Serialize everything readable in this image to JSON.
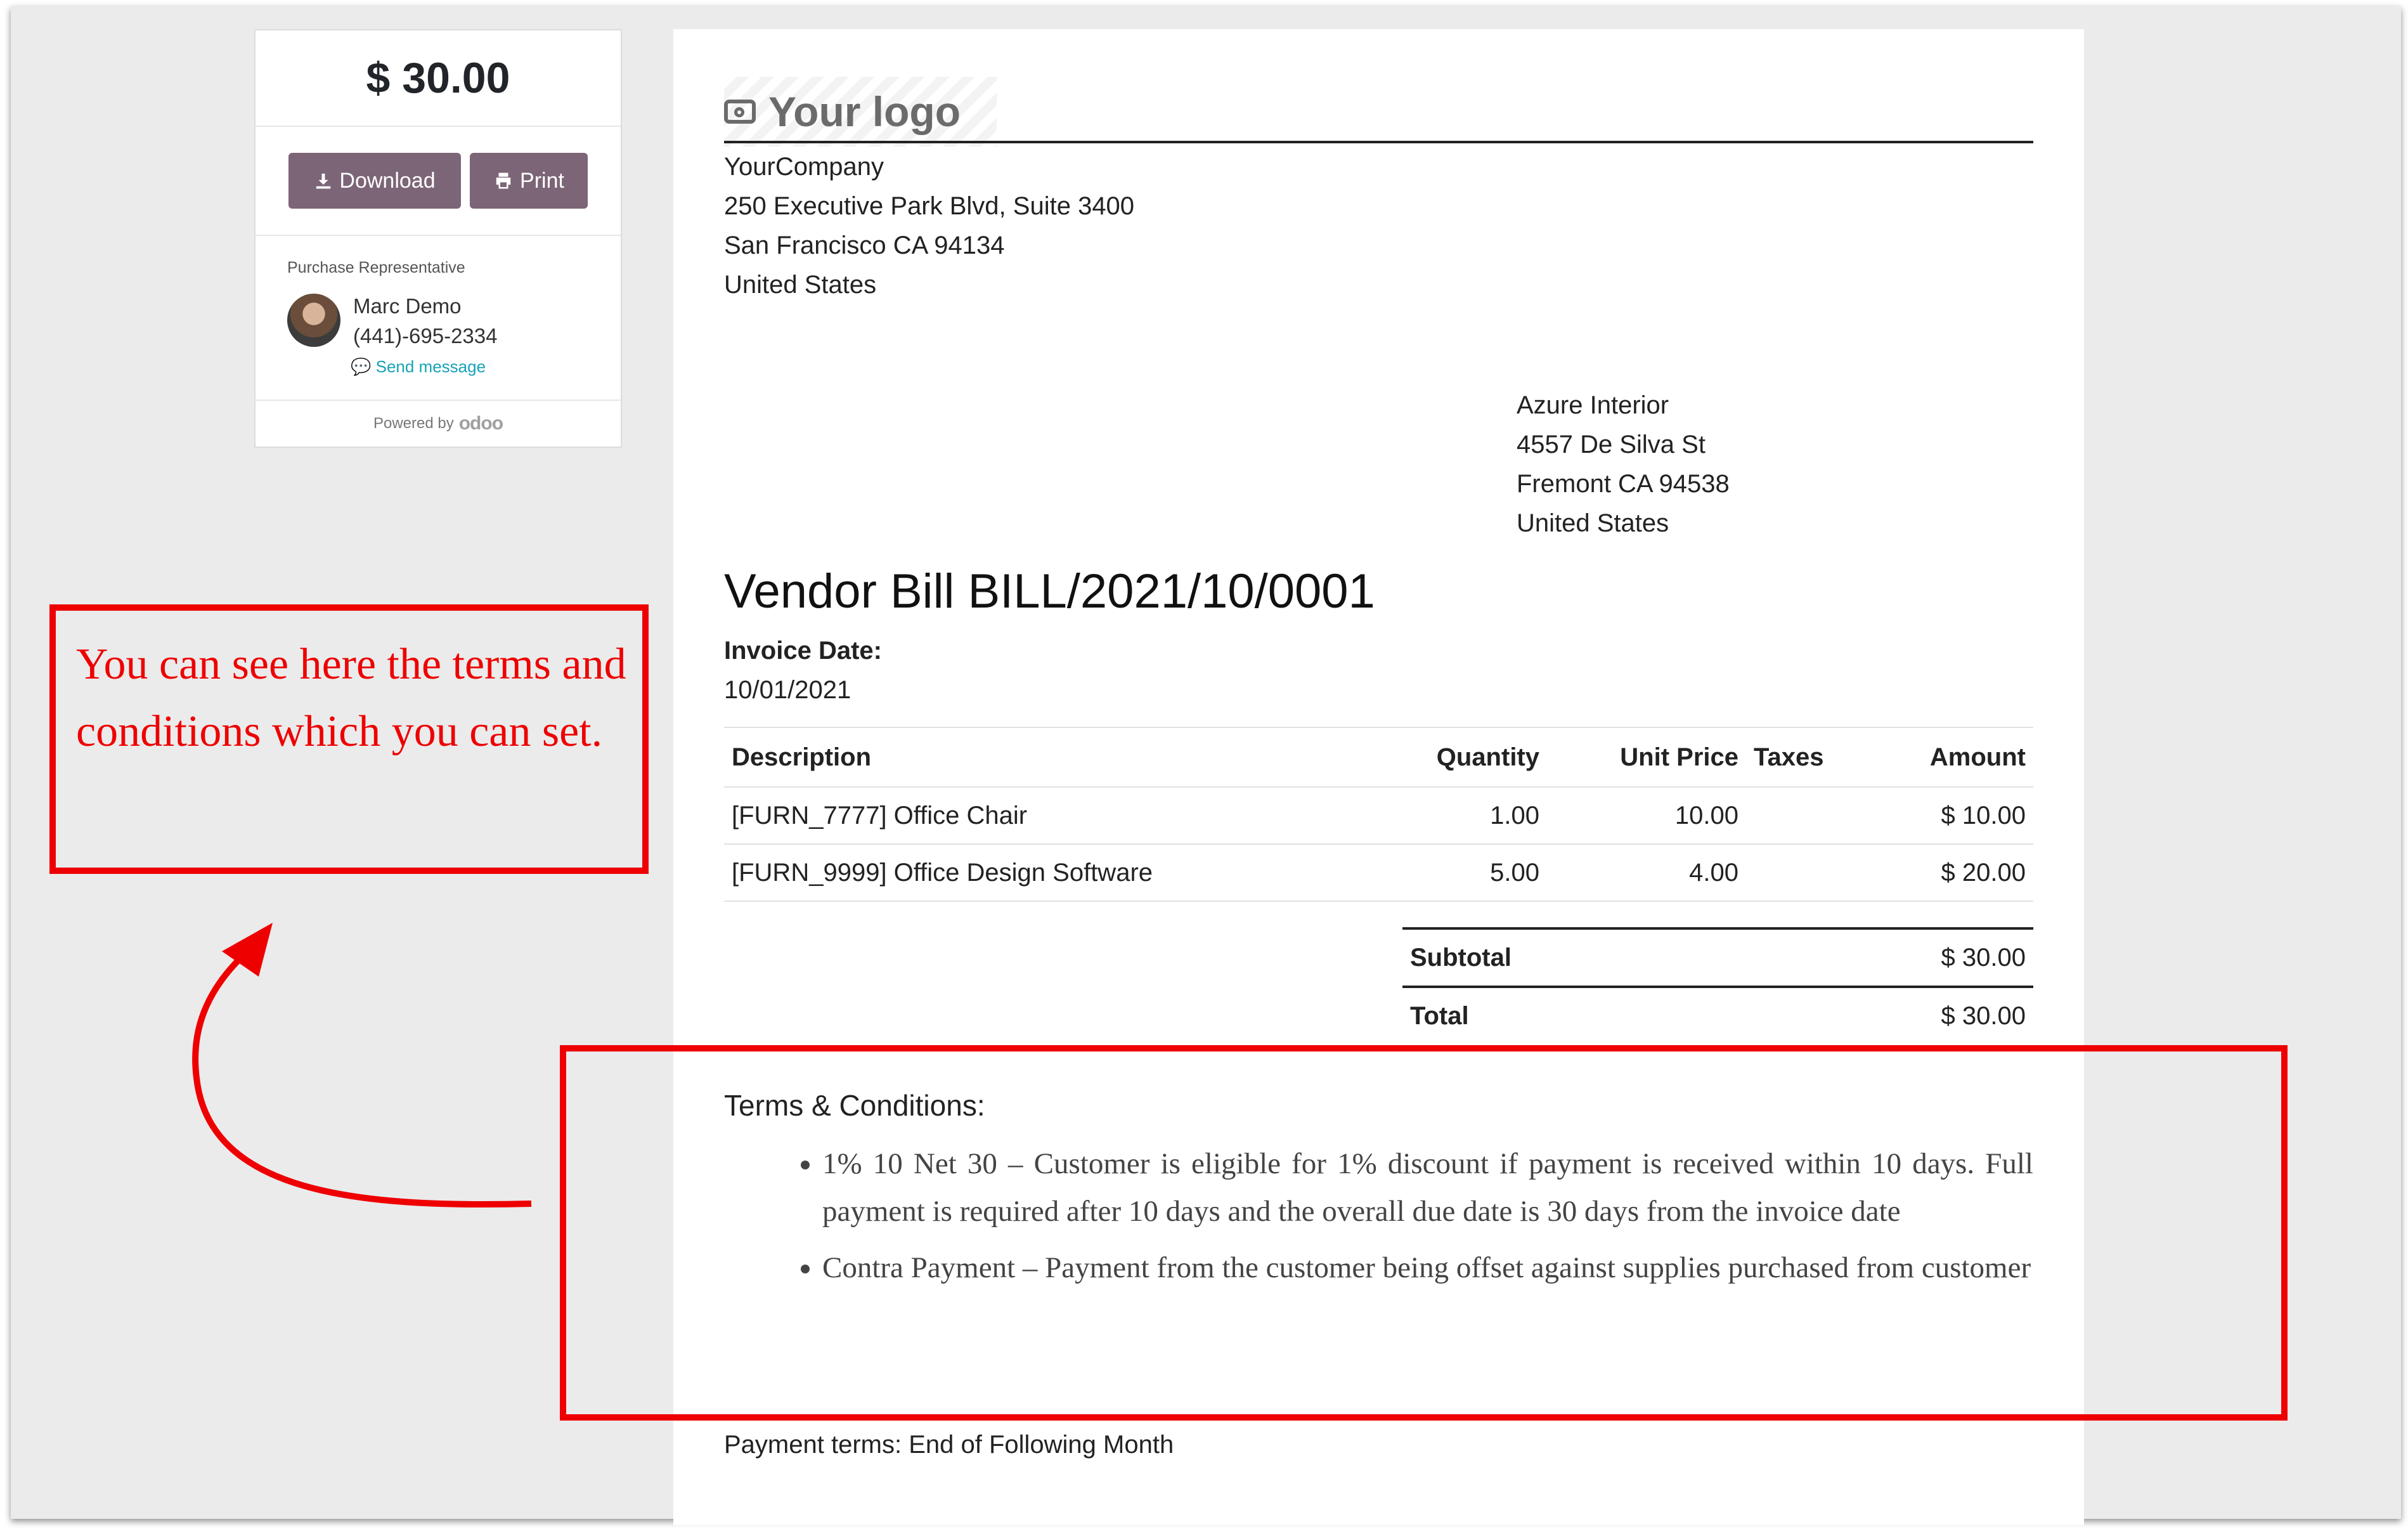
{
  "sidebar": {
    "amount": "$ 30.00",
    "download_label": "Download",
    "print_label": "Print",
    "rep_label": "Purchase Representative",
    "rep_name": "Marc Demo",
    "rep_phone": "(441)-695-2334",
    "send_message": "Send message",
    "powered_by": "Powered by",
    "brand": "odoo"
  },
  "document": {
    "logo_text": "Your logo",
    "company": {
      "name": "YourCompany",
      "street": "250 Executive Park Blvd, Suite 3400",
      "city": "San Francisco CA 94134",
      "country": "United States"
    },
    "partner": {
      "name": "Azure Interior",
      "street": "4557 De Silva St",
      "city": "Fremont CA 94538",
      "country": "United States"
    },
    "title": "Vendor Bill BILL/2021/10/0001",
    "invoice_date_label": "Invoice Date:",
    "invoice_date": "10/01/2021",
    "columns": [
      "Description",
      "Quantity",
      "Unit Price",
      "Taxes",
      "Amount"
    ],
    "lines": [
      {
        "description": "[FURN_7777] Office Chair",
        "quantity": "1.00",
        "unit_price": "10.00",
        "taxes": "",
        "amount": "$ 10.00"
      },
      {
        "description": "[FURN_9999] Office Design Software",
        "quantity": "5.00",
        "unit_price": "4.00",
        "taxes": "",
        "amount": "$ 20.00"
      }
    ],
    "subtotal_label": "Subtotal",
    "subtotal": "$ 30.00",
    "total_label": "Total",
    "total": "$ 30.00",
    "terms_heading": "Terms & Conditions:",
    "terms": [
      "1% 10 Net 30 – Customer is eligible for 1% discount if payment is received within 10 days. Full payment is required after 10 days and the overall due date is 30 days from the invoice date",
      "Contra Payment – Payment from the customer being offset against supplies purchased from customer"
    ],
    "payment_terms": "Payment terms: End of Following Month"
  },
  "annotation": {
    "note": "You can see here the terms and conditions which you can set.",
    "color": "#ee0000"
  }
}
